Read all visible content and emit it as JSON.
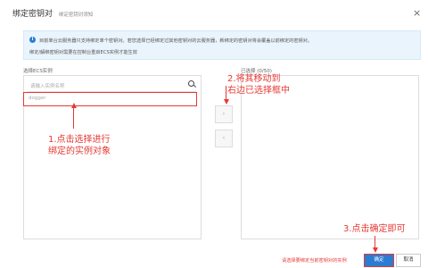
{
  "dialog": {
    "title": "绑定密钥对",
    "subtitle": "绑定密钥对须知",
    "close_glyph": "×"
  },
  "info": {
    "icon": "info-icon",
    "line1": "目前单台云服务器只支持绑定单个密钥对。若您选择已经绑定过其他密钥对的云服务器，新绑定的密钥对将会覆盖以前绑定的密钥对。",
    "line2": "绑定/解绑密钥对需要在控制台重启ECS实例才能生效"
  },
  "left_panel": {
    "label": "选择ECS实例",
    "search_placeholder": "请输入实例名称",
    "items": [
      "dogger"
    ]
  },
  "right_panel": {
    "label": "已选择",
    "count": "(0/50)"
  },
  "transfer": {
    "move_right_glyph": "›",
    "move_left_glyph": "‹"
  },
  "annotations": {
    "step1_line1": "1.点击选择进行",
    "step1_line2": "绑定的实例对象",
    "step2_line1": "2.将其移动到",
    "step2_line2": "右边已选择框中",
    "step3": "3.点击确定即可"
  },
  "footer": {
    "hint": "请选择要绑定当前密钥对的实例",
    "ok_label": "确定",
    "cancel_label": "取消"
  },
  "colors": {
    "annotation": "#e53935",
    "primary": "#2b7cd3",
    "info_bg": "#eaf4fc"
  }
}
